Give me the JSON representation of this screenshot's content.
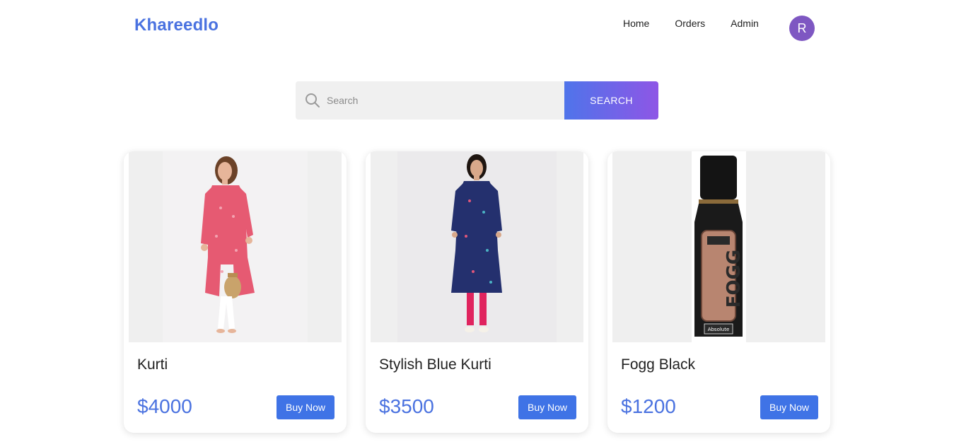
{
  "brand": "Khareedlo",
  "nav": {
    "home": "Home",
    "orders": "Orders",
    "admin": "Admin",
    "avatar_initial": "R"
  },
  "search": {
    "placeholder": "Search",
    "value": "",
    "button_label": "SEARCH"
  },
  "products": [
    {
      "name": "Kurti",
      "price": "$4000",
      "buy_label": "Buy Now",
      "image": "pink-kurti-model-image"
    },
    {
      "name": "Stylish Blue Kurti",
      "price": "$3500",
      "buy_label": "Buy Now",
      "image": "blue-kurti-model-image"
    },
    {
      "name": "Fogg Black",
      "price": "$1200",
      "buy_label": "Buy Now",
      "image": "fogg-black-deodorant-image",
      "image_text": "FOGG",
      "image_subtext": "Absolute"
    }
  ],
  "colors": {
    "brand": "#4a72e0",
    "avatar": "#7e57c2",
    "button": "#3f73e6",
    "search_gradient_start": "#4f74ea",
    "search_gradient_end": "#8e56e6"
  }
}
